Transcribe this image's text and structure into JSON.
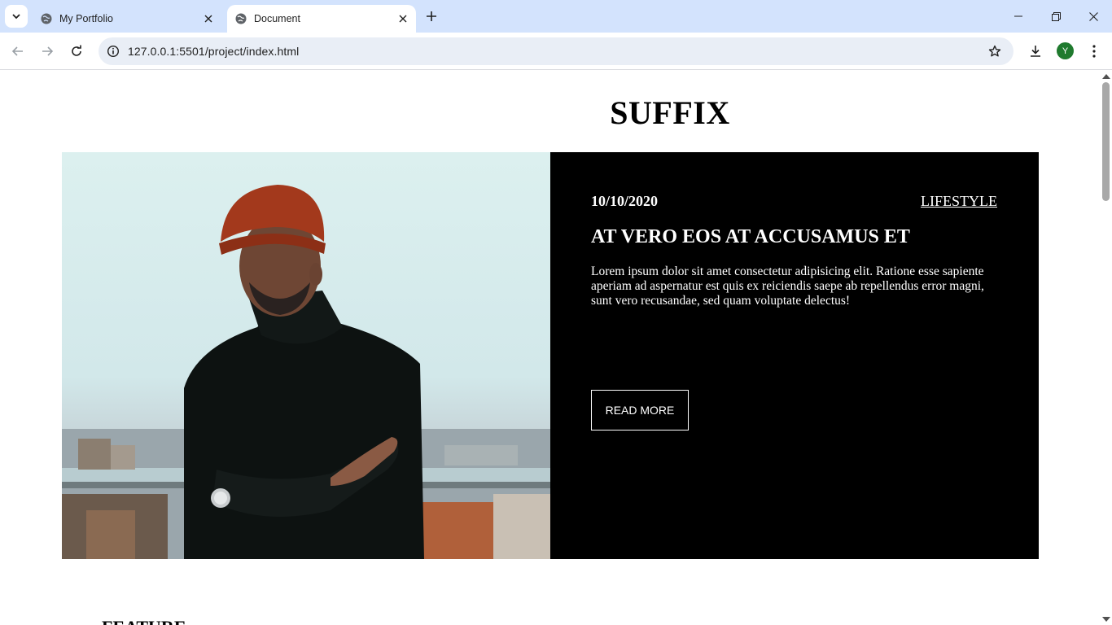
{
  "browser": {
    "tabs": [
      {
        "title": "My Portfolio",
        "active": false
      },
      {
        "title": "Document",
        "active": true
      }
    ],
    "url": "127.0.0.1:5501/project/index.html",
    "profile_initial": "Y"
  },
  "page": {
    "site_title": "SUFFIX",
    "hero": {
      "date": "10/10/2020",
      "category": "LIFESTYLE",
      "title": "AT VERO EOS AT ACCUSAMUS ET",
      "excerpt": "Lorem ipsum dolor sit amet consectetur adipisicing elit. Ratione esse sapiente aperiam ad aspernatur est quis ex reiciendis saepe ab repellendus error magni, sunt vero recusandae, sed quam voluptate delectus!",
      "button_label": "READ MORE"
    },
    "feature_heading": "FEATURE"
  },
  "colors": {
    "tabstrip": "#d3e3fd",
    "omnibox": "#e9eef6",
    "hero_panel": "#000000",
    "avatar": "#1f7a2e"
  }
}
